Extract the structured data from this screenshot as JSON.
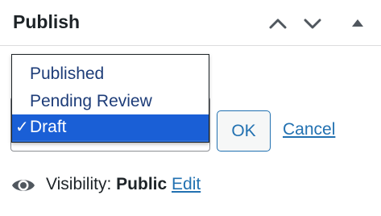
{
  "panel": {
    "title": "Publish",
    "icons": {
      "move_up": "chevron-up-icon",
      "move_down": "chevron-down-icon",
      "toggle": "triangle-up-icon"
    }
  },
  "status": {
    "options": [
      "Published",
      "Pending Review",
      "Draft"
    ],
    "selected": "Draft",
    "check_mark": "✓",
    "ok_label": "OK",
    "cancel_label": "Cancel"
  },
  "visibility": {
    "icon": "eye-icon",
    "label": "Visibility:",
    "value": "Public",
    "edit_label": "Edit"
  },
  "colors": {
    "selection": "#1a5fd6",
    "link": "#2271b1",
    "option_text": "#1d3c78"
  }
}
